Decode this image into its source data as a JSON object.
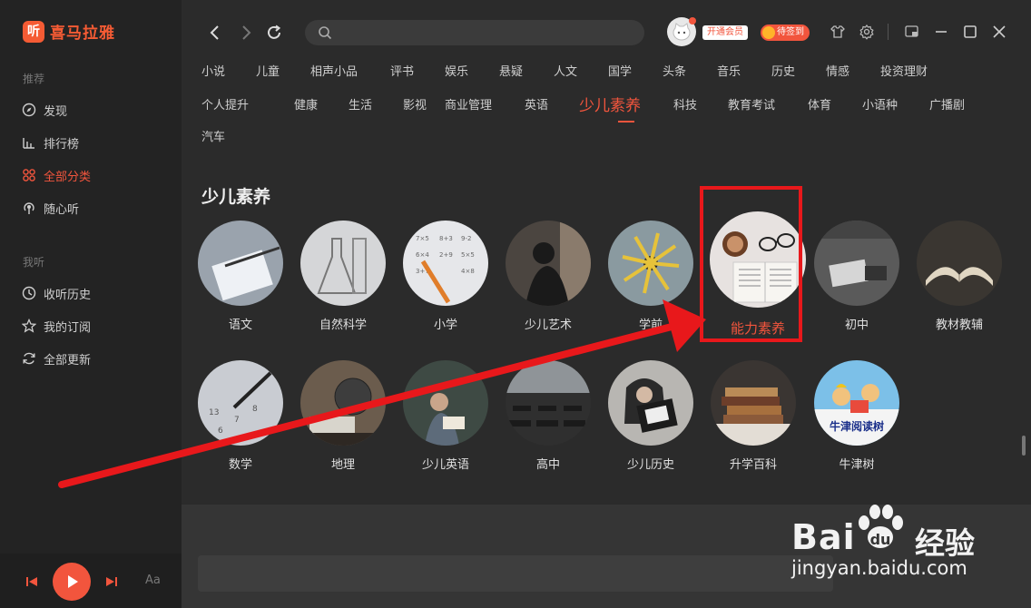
{
  "app": {
    "logo_char": "听",
    "logo_text": "喜马拉雅"
  },
  "sidebar": {
    "section_recommend": "推荐",
    "recommend_items": [
      {
        "label": "发现",
        "icon": "compass-icon"
      },
      {
        "label": "排行榜",
        "icon": "bar-chart-icon"
      },
      {
        "label": "全部分类",
        "icon": "grid-icon"
      },
      {
        "label": "随心听",
        "icon": "radio-icon"
      }
    ],
    "section_mine": "我听",
    "mine_items": [
      {
        "label": "收听历史",
        "icon": "clock-icon"
      },
      {
        "label": "我的订阅",
        "icon": "star-icon"
      },
      {
        "label": "全部更新",
        "icon": "refresh-icon"
      }
    ]
  },
  "player": {
    "font_label": "Aa"
  },
  "topbar": {
    "vip_label": "开通会员",
    "sign_label": "待签到",
    "search_placeholder": ""
  },
  "categories": {
    "row1": [
      "小说",
      "儿童",
      "相声小品",
      "评书",
      "娱乐",
      "悬疑",
      "人文",
      "国学",
      "头条",
      "音乐",
      "历史",
      "情感",
      "投资理财"
    ],
    "row2": [
      "个人提升",
      "健康",
      "生活",
      "影视",
      "商业管理",
      "英语",
      "少儿素养",
      "科技",
      "教育考试",
      "体育",
      "小语种",
      "广播剧"
    ],
    "row3": [
      "汽车"
    ],
    "active": "少儿素养"
  },
  "section": {
    "title": "少儿素养",
    "row1": [
      "语文",
      "自然科学",
      "小学",
      "少儿艺术",
      "学前",
      "能力素养",
      "初中",
      "教材教辅"
    ],
    "row2": [
      "数学",
      "地理",
      "少儿英语",
      "高中",
      "少儿历史",
      "升学百科",
      "牛津树"
    ],
    "highlighted": "能力素养",
    "oxford_badge": "牛津阅读树"
  },
  "watermark": {
    "brand_left": "Bai",
    "brand_right": "du",
    "brand_cn": "经验",
    "url": "jingyan.baidu.com"
  },
  "colors": {
    "accent": "#f2553d",
    "annotation_red": "#e8181b",
    "sidebar_bg": "#232323",
    "main_bg": "#2b2b2b"
  }
}
